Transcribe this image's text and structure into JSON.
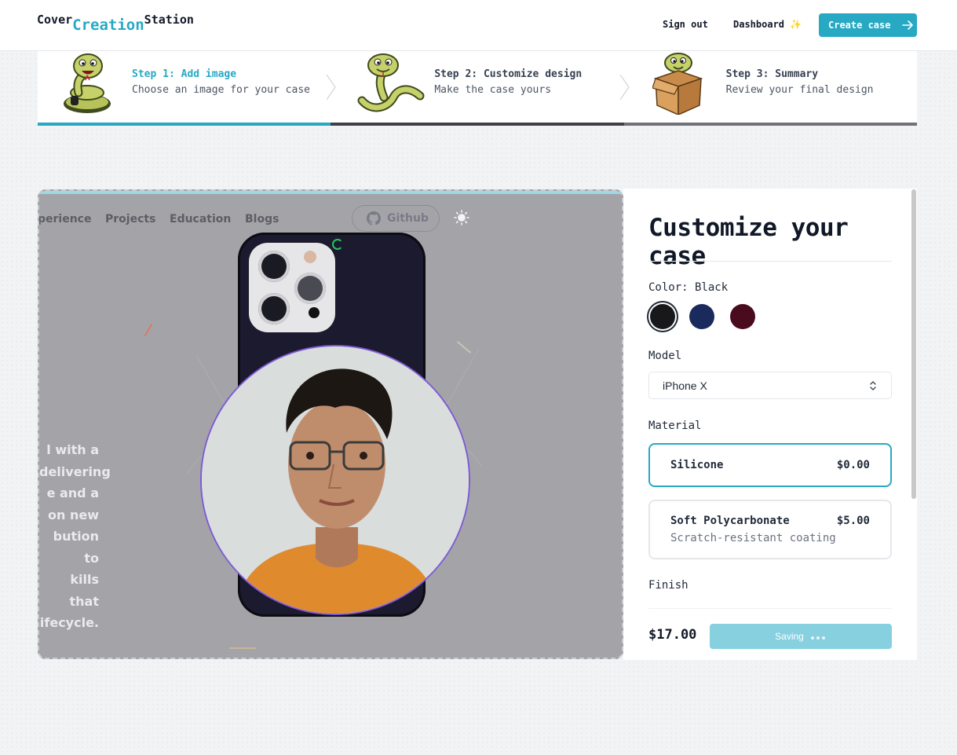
{
  "header": {
    "logo": {
      "part1": "Cover",
      "part2": "Creation",
      "part3": "Station"
    },
    "nav": {
      "sign_out": "Sign out",
      "dashboard": "Dashboard ✨"
    },
    "create_case": "Create case"
  },
  "steps": [
    {
      "title": "Step 1: Add image",
      "desc": "Choose an image for your case",
      "state": "current"
    },
    {
      "title": "Step 2: Customize design",
      "desc": "Make the case yours",
      "state": "complete"
    },
    {
      "title": "Step 3: Summary",
      "desc": "Review your final design",
      "state": "upcoming"
    }
  ],
  "preview": {
    "nav_items": [
      "perience",
      "Projects",
      "Education",
      "Blogs"
    ],
    "github_label": "Github",
    "side_lines": [
      "l with a",
      "delivering",
      "e and a",
      "on new",
      "bution to",
      "kills that",
      "ifecycle."
    ]
  },
  "customize": {
    "heading": "Customize your case",
    "color_label": "Color: Black",
    "colors": [
      {
        "name": "Black",
        "hex": "#18181b",
        "selected": true
      },
      {
        "name": "Blue",
        "hex": "#1b2a5c",
        "selected": false
      },
      {
        "name": "Rose",
        "hex": "#4a0b1e",
        "selected": false
      }
    ],
    "model_label": "Model",
    "model_value": "iPhone X",
    "material_label": "Material",
    "materials": [
      {
        "name": "Silicone",
        "sub": "",
        "price": "$0.00",
        "selected": true
      },
      {
        "name": "Soft Polycarbonate",
        "sub": "Scratch-resistant coating",
        "price": "$5.00",
        "selected": false
      }
    ],
    "finish_label": "Finish",
    "total": "$17.00",
    "saving_label": "Saving"
  },
  "colors": {
    "accent": "#27a9c4",
    "accent_light": "#86d0e0",
    "selected_border": "#1f2937"
  }
}
